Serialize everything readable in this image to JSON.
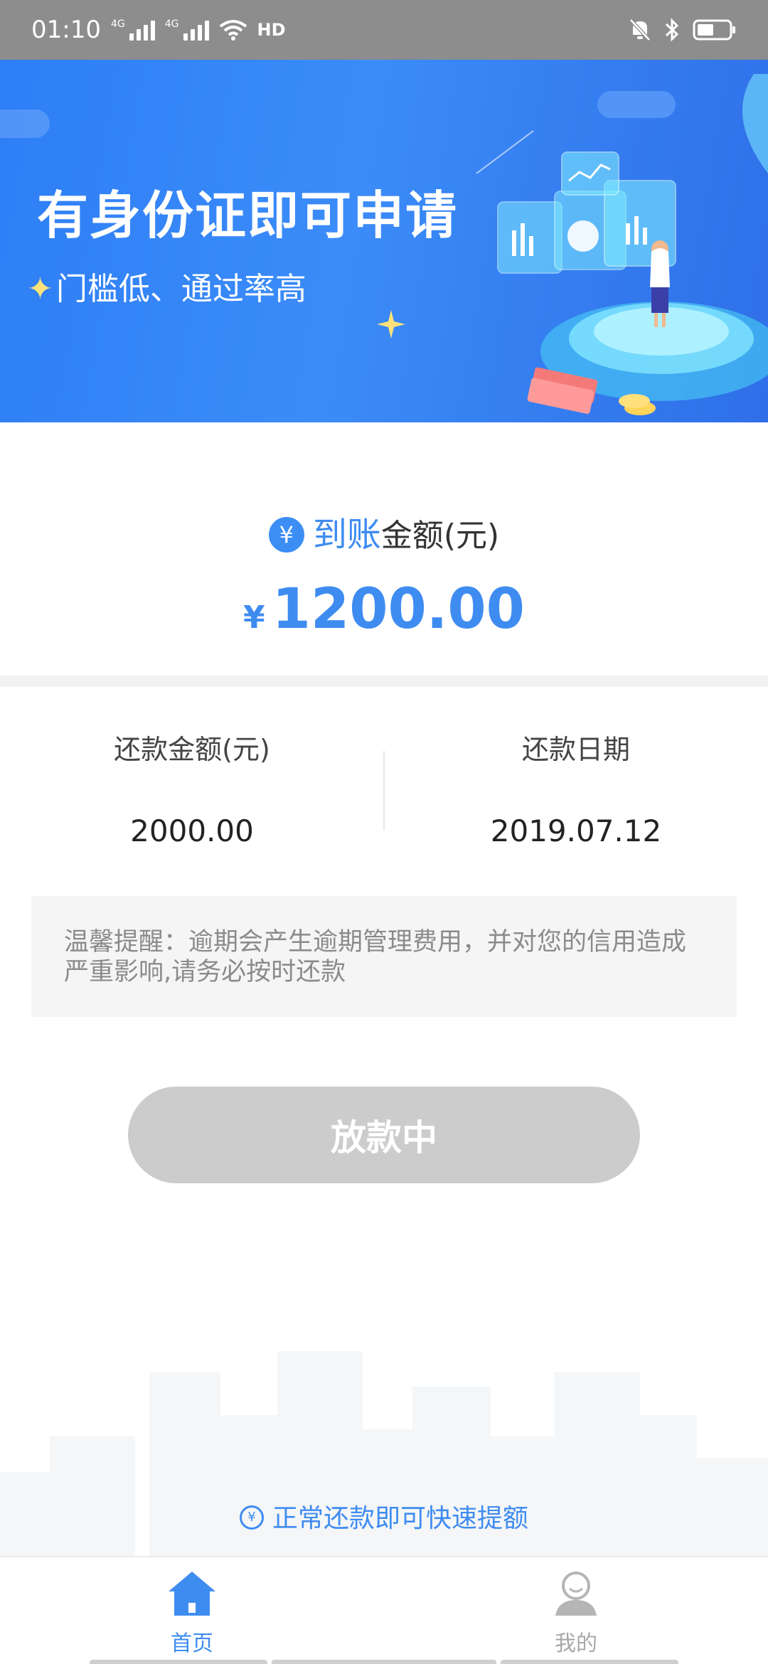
{
  "status_bar": {
    "time": "01:10",
    "network_1": "4G",
    "network_2": "4G",
    "hd_label": "HD",
    "icons": [
      "signal-icon",
      "wifi-icon",
      "hd-call-icon",
      "mute-icon",
      "bluetooth-icon",
      "battery-icon"
    ]
  },
  "banner": {
    "title": "有身份证即可申请",
    "subtitle": "门槛低、通过率高",
    "colors": {
      "bg_start": "#2e7ef6",
      "bg_end": "#2f6fe8"
    }
  },
  "amount": {
    "icon_glyph": "¥",
    "label_highlight": "到账",
    "label_rest": "金额(元)",
    "currency_symbol": "¥",
    "value": "1200.00"
  },
  "repayment": {
    "amount_label": "还款金额(元)",
    "amount_value": "2000.00",
    "date_label": "还款日期",
    "date_value": "2019.07.12"
  },
  "notice": {
    "text": "温馨提醒：逾期会产生逾期管理费用，并对您的信用造成严重影响,请务必按时还款"
  },
  "action_button": {
    "label": "放款中"
  },
  "promo": {
    "icon_glyph": "¥",
    "text": "正常还款即可快速提额"
  },
  "bottom_nav": {
    "items": [
      {
        "label": "首页",
        "icon": "home-icon",
        "active": true
      },
      {
        "label": "我的",
        "icon": "user-icon",
        "active": false
      }
    ]
  },
  "theme": {
    "accent": "#3f8cf1",
    "disabled": "#cccccc"
  }
}
